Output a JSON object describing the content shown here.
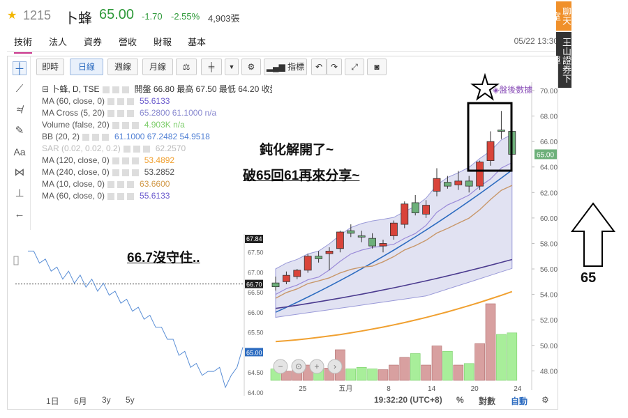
{
  "header": {
    "star_icon": "star-icon",
    "code": "1215",
    "name": "卜蜂",
    "price": "65.00",
    "change": "-1.70",
    "change_pct": "-2.55%",
    "volume": "4,903張",
    "color_down": "#2f9a3a"
  },
  "tabs": [
    {
      "label": "技術",
      "active": true
    },
    {
      "label": "法人"
    },
    {
      "label": "資券"
    },
    {
      "label": "營收"
    },
    {
      "label": "財報"
    },
    {
      "label": "基本"
    }
  ],
  "datetime": "05/22 13:30",
  "side_tags": {
    "chat": "聊天室",
    "order": "王山證券下單"
  },
  "toolbar": {
    "buttons": [
      "即時",
      "日線",
      "週線",
      "月線"
    ],
    "active": "日線",
    "indicator_label": "指標",
    "icons": [
      "scale-icon",
      "candle-icon",
      "dropdown-icon",
      "gear-icon",
      "indicator-icon",
      "undo-icon",
      "redo-icon",
      "fullscreen-icon",
      "camera-icon"
    ]
  },
  "left_tools": [
    "crosshair-icon",
    "line-icon",
    "fib-icon",
    "brush-icon",
    "text-icon",
    "pattern-icon",
    "measure-icon",
    "back-icon"
  ],
  "legend": [
    {
      "text": "卜蜂, D, TSE",
      "values": "開盤 66.80 最高 67.50 最低 64.20 收盤 65.00",
      "color": "#333"
    },
    {
      "text": "MA (60, close, 0)",
      "values": "55.6133",
      "color": "#6a5acd"
    },
    {
      "text": "MA Cross (5, 20)",
      "values": "65.2800 61.1000 n/a",
      "color": "#8a8ad0"
    },
    {
      "text": "Volume (false, 20)",
      "values": "4.903K n/a",
      "color": "#7ccd6a"
    },
    {
      "text": "BB (20, 2)",
      "values": "61.1000 67.2482 54.9518",
      "color": "#4f7fd4"
    },
    {
      "text": "SAR (0.02, 0.02, 0.2)",
      "values": "62.2570",
      "color": "#bbb"
    },
    {
      "text": "MA (120, close, 0)",
      "values": "53.4892",
      "color": "#f0a030"
    },
    {
      "text": "MA (240, close, 0)",
      "values": "53.2852",
      "color": "#555"
    },
    {
      "text": "MA (10, close, 0)",
      "values": "63.6600",
      "color": "#d29a4a"
    },
    {
      "text": "MA (60, close, 0)",
      "values": "55.6133",
      "color": "#6a5acd"
    }
  ],
  "after_hours": "盤後數據",
  "annotations": {
    "blunt": "鈍化解開了~",
    "break": "破65回61再來分享~",
    "not_hold": "66.7沒守住..",
    "arrow_value": "65"
  },
  "main_axis": {
    "ticks": [
      "70.00",
      "68.00",
      "66.00",
      "64.00",
      "62.00",
      "60.00",
      "58.00",
      "56.00",
      "54.00",
      "52.00",
      "50.00",
      "48.00"
    ],
    "current": "65.00",
    "x_labels": [
      "25",
      "五月",
      "8",
      "14",
      "20",
      "24"
    ]
  },
  "inset_axis": {
    "ticks": [
      "67.84",
      "67.50",
      "67.00",
      "66.70",
      "66.50",
      "66.00",
      "65.50",
      "65.00",
      "64.50",
      "64.00"
    ],
    "reference": "66.70",
    "current": "65.00"
  },
  "bottom_bar": {
    "ranges": [
      "1日",
      "6月",
      "3y",
      "5y"
    ],
    "time": "19:32:20 (UTC+8)",
    "pct": "%",
    "log": "對數",
    "auto": "自動"
  },
  "colors": {
    "up": "#d9443a",
    "down": "#6db07a",
    "band": "#c9cbe8",
    "ma_blue": "#2d6cc0",
    "ma_purple": "#4b3b8f",
    "ma_orange": "#f0a030",
    "ma_brown": "#c8976a",
    "vol_up": "#d8a0a0",
    "vol_down": "#a8ee9a",
    "accent": "#2d6cc0"
  },
  "chart_data": {
    "type": "line",
    "series": [
      {
        "values": [
          67.6,
          67.4,
          67.3,
          67.2,
          67.1,
          67.0,
          66.9,
          66.9,
          66.8,
          66.8,
          66.7,
          66.7,
          66.6,
          66.6,
          66.5,
          66.4,
          66.3,
          66.2,
          66.1,
          66.0,
          65.9,
          65.8,
          65.7,
          65.5,
          65.4,
          65.2,
          65.0,
          64.9,
          64.7,
          64.6,
          64.5,
          64.4,
          64.6,
          64.5,
          64.2,
          64.3,
          64.7,
          65.0
        ]
      }
    ],
    "ylim": [
      64.0,
      67.84
    ],
    "candles": {
      "ohlc": [
        [
          54.9,
          55.4,
          54.3,
          54.6
        ],
        [
          55.0,
          55.8,
          54.8,
          55.5
        ],
        [
          55.4,
          56.0,
          55.2,
          55.9
        ],
        [
          55.9,
          57.2,
          55.7,
          57.0
        ],
        [
          57.0,
          57.4,
          56.5,
          56.8
        ],
        [
          57.2,
          57.7,
          55.9,
          57.4
        ],
        [
          57.6,
          59.0,
          57.3,
          58.9
        ],
        [
          59.0,
          59.5,
          58.5,
          58.8
        ],
        [
          58.6,
          59.0,
          58.1,
          58.5
        ],
        [
          58.4,
          58.8,
          57.6,
          57.8
        ],
        [
          57.8,
          58.3,
          57.3,
          58.0
        ],
        [
          58.6,
          59.8,
          58.3,
          59.6
        ],
        [
          59.5,
          61.3,
          59.2,
          61.1
        ],
        [
          61.2,
          61.8,
          60.2,
          60.4
        ],
        [
          60.3,
          61.4,
          60.0,
          61.0
        ],
        [
          62.1,
          63.9,
          61.7,
          63.1
        ],
        [
          62.8,
          63.3,
          62.3,
          62.5
        ],
        [
          62.6,
          63.7,
          62.2,
          62.9
        ],
        [
          62.9,
          63.3,
          62.0,
          62.5
        ],
        [
          62.5,
          64.5,
          62.2,
          64.4
        ],
        [
          64.5,
          66.8,
          64.1,
          66.0
        ],
        [
          66.9,
          68.4,
          66.2,
          66.8
        ],
        [
          66.8,
          67.5,
          64.2,
          65.0
        ]
      ],
      "ylim": [
        47.8,
        70.0
      ]
    }
  }
}
